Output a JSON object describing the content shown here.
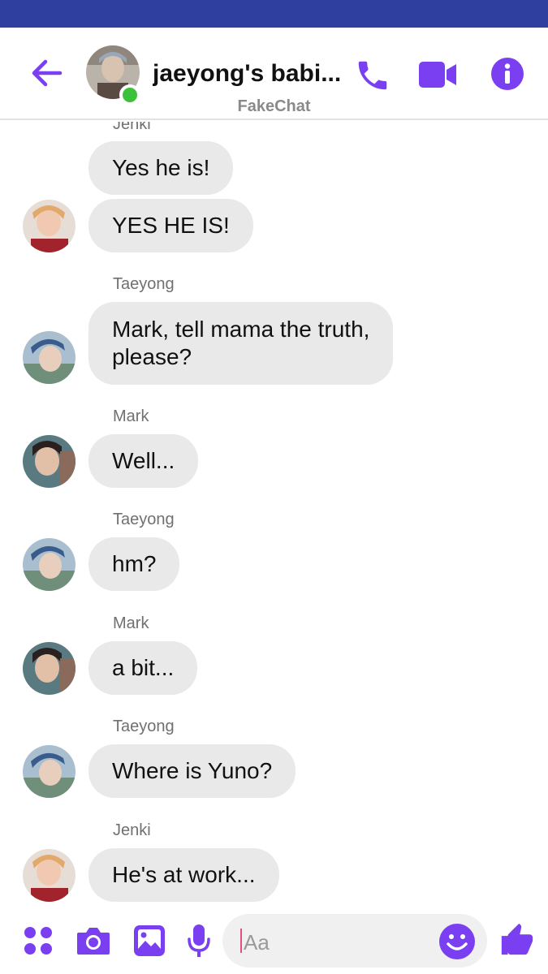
{
  "header": {
    "title": "jaeyong's babi...",
    "watermark": "FakeChat",
    "icons": {
      "back": "arrow-left-icon",
      "call": "phone-icon",
      "video": "video-camera-icon",
      "info": "info-icon"
    },
    "online": true
  },
  "colors": {
    "accent": "#7b3ff2",
    "status_bar": "#2f3f9f",
    "bubble": "#e9e9e9",
    "online": "#3cc13b"
  },
  "messages": [
    {
      "sender": "Jenki",
      "texts": [
        "Yes he is!",
        "YES HE IS!"
      ]
    },
    {
      "sender": "Taeyong",
      "texts": [
        "Mark, tell mama the truth,\nplease?"
      ]
    },
    {
      "sender": "Mark",
      "texts": [
        "Well..."
      ]
    },
    {
      "sender": "Taeyong",
      "texts": [
        "hm?"
      ]
    },
    {
      "sender": "Mark",
      "texts": [
        "a bit..."
      ]
    },
    {
      "sender": "Taeyong",
      "texts": [
        "Where is Yuno?"
      ]
    },
    {
      "sender": "Jenki",
      "texts": [
        "He's at work..."
      ]
    }
  ],
  "composer": {
    "placeholder": "Aa",
    "icons": [
      "apps-menu-icon",
      "camera-icon",
      "gallery-icon",
      "microphone-icon",
      "emoji-icon",
      "thumbs-up-icon"
    ]
  }
}
